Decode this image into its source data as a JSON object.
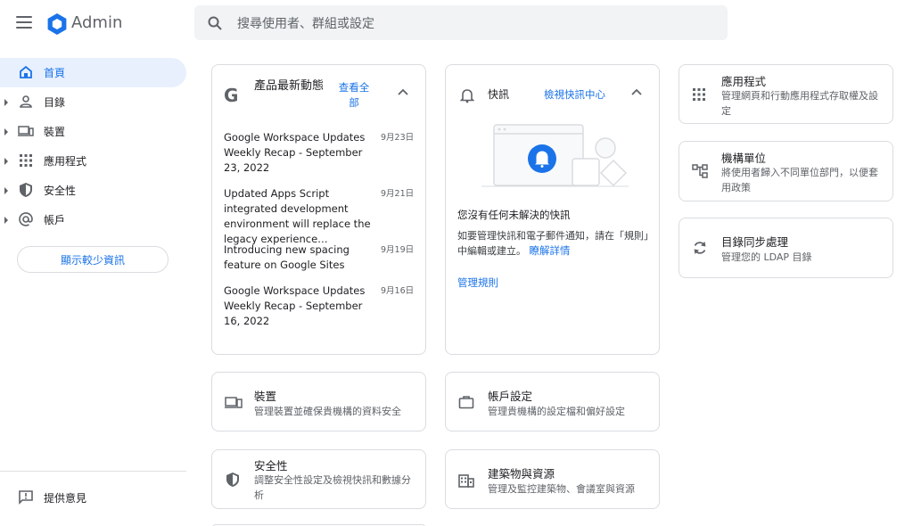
{
  "header": {
    "brand": "Admin",
    "search_placeholder": "搜尋使用者、群組或設定"
  },
  "sidebar": {
    "items": [
      {
        "label": "首頁",
        "icon": "home-icon",
        "active": true
      },
      {
        "label": "目錄",
        "icon": "person-icon"
      },
      {
        "label": "裝置",
        "icon": "devices-icon"
      },
      {
        "label": "應用程式",
        "icon": "apps-grid-icon"
      },
      {
        "label": "安全性",
        "icon": "shield-icon"
      },
      {
        "label": "帳戶",
        "icon": "at-icon"
      }
    ],
    "show_less": "顯示較少資訊",
    "feedback": "提供意見"
  },
  "updates": {
    "title": "產品最新動態",
    "view_all": "查看全部",
    "items": [
      {
        "title": "Google Workspace Updates Weekly Recap - September 23, 2022",
        "date": "9月23日"
      },
      {
        "title": "Updated Apps Script integrated development environment will replace the legacy experience…",
        "date": "9月21日"
      },
      {
        "title": "Introducing new spacing feature on Google Sites",
        "date": "9月19日"
      },
      {
        "title": "Google Workspace Updates Weekly Recap - September 16, 2022",
        "date": "9月16日"
      }
    ]
  },
  "alerts": {
    "title": "快訊",
    "center_link": "檢視快訊中心",
    "empty": "您沒有任何未解決的快訊",
    "body": "如要管理快訊和電子郵件通知，請在「規則」中編輯或建立。",
    "learn_more": "瞭解詳情",
    "rules_link": "管理規則"
  },
  "tiles": {
    "devices": {
      "title": "裝置",
      "desc": "管理裝置並確保貴機構的資料安全"
    },
    "account": {
      "title": "帳戶設定",
      "desc": "管理貴機構的設定檔和偏好設定"
    },
    "security": {
      "title": "安全性",
      "desc": "調整安全性設定及檢視快訊和數據分析"
    },
    "buildings": {
      "title": "建築物與資源",
      "desc": "管理及監控建築物、會議室與資源"
    },
    "apps": {
      "title": "應用程式",
      "desc": "管理網頁和行動應用程式存取權及設定"
    },
    "org_units": {
      "title": "機構單位",
      "desc": "將使用者歸入不同單位部門，以便套用政策"
    },
    "dir_sync": {
      "title": "目錄同步處理",
      "desc": "管理您的 LDAP 目錄"
    }
  },
  "colors": {
    "accent": "#1a73e8",
    "logo": "#1a73e8",
    "border": "#dadce0"
  }
}
